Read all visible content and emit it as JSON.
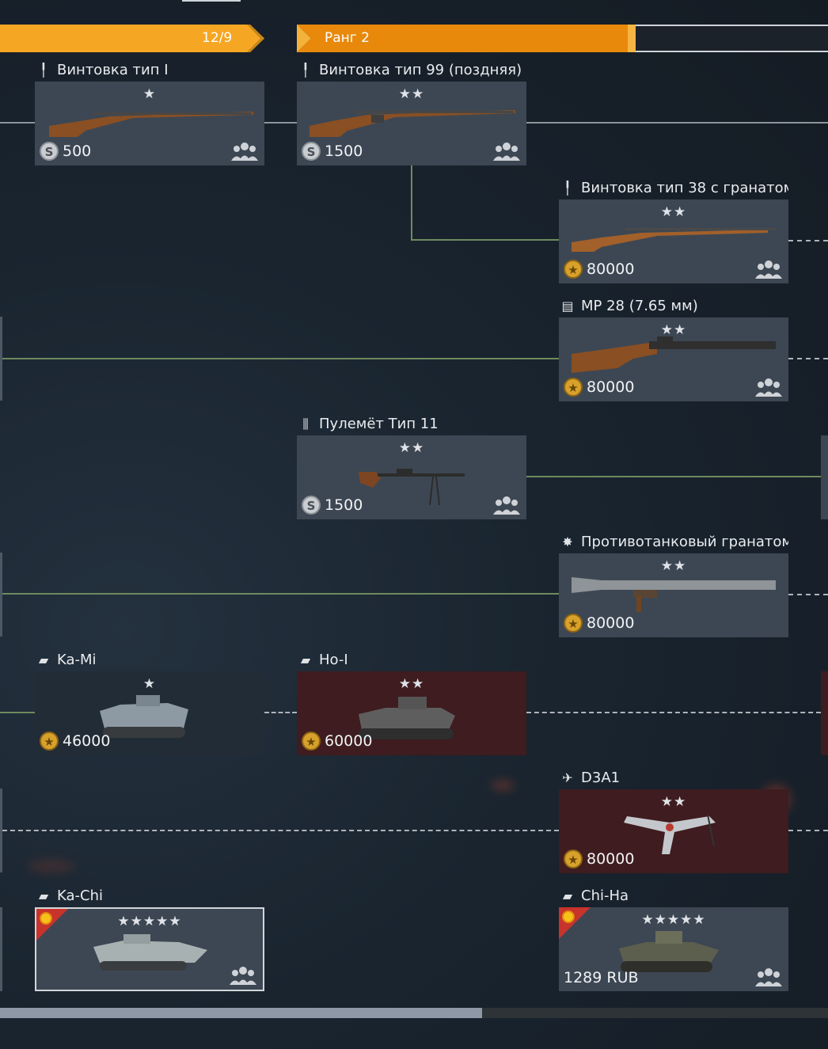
{
  "rank_bars": [
    {
      "label": "12/9",
      "progress": 1.0
    },
    {
      "label": "Ранг 2",
      "progress": 0.6
    }
  ],
  "cards": [
    {
      "title": "Винтовка тип I",
      "type_icon": "rifle-icon",
      "stars": "★",
      "price": "500",
      "currency": "silver",
      "squad": true
    },
    {
      "title": "Винтовка тип 99 (поздняя)",
      "type_icon": "rifle-icon",
      "stars": "★★",
      "price": "1500",
      "currency": "silver",
      "squad": true
    },
    {
      "title": "Винтовка тип 38 с гранатом",
      "type_icon": "rifle-icon",
      "stars": "★★",
      "price": "80000",
      "currency": "gold",
      "squad": true
    },
    {
      "title": "MP 28 (7.65 мм)",
      "type_icon": "submachine-gun-icon",
      "stars": "★★",
      "price": "80000",
      "currency": "gold",
      "squad": true
    },
    {
      "title": "Пулемёт Тип 11",
      "type_icon": "machine-gun-icon",
      "stars": "★★",
      "price": "1500",
      "currency": "silver",
      "squad": true
    },
    {
      "title": "Противотанковый гранатом",
      "type_icon": "explosion-icon",
      "stars": "★★",
      "price": "80000",
      "currency": "gold",
      "squad": false
    },
    {
      "title": "Ka-Mi",
      "type_icon": "tank-icon",
      "stars": "★",
      "price": "46000",
      "currency": "gold",
      "squad": false
    },
    {
      "title": "Ho-I",
      "type_icon": "tank-icon",
      "stars": "★★",
      "price": "60000",
      "currency": "gold",
      "squad": false
    },
    {
      "title": "D3A1",
      "type_icon": "plane-icon",
      "stars": "★★",
      "price": "80000",
      "currency": "gold",
      "squad": false
    },
    {
      "title": "Ka-Chi",
      "type_icon": "tank-icon",
      "stars": "★★★★★",
      "price": "",
      "currency": "none",
      "squad": true
    },
    {
      "title": "Chi-Ha",
      "type_icon": "tank-icon",
      "stars": "★★★★★",
      "price": "1289 RUB",
      "currency": "none",
      "squad": true
    }
  ],
  "colors": {
    "rank_bar_gold": "#f5a623",
    "rank_bar_orange": "#e8890c",
    "line_green": "#6f8a5e",
    "card_bg": "#3d4753",
    "card_premium_red": "#3e1c1f"
  },
  "scrollbar": {
    "position": 0.0,
    "visible_fraction": 0.58
  }
}
